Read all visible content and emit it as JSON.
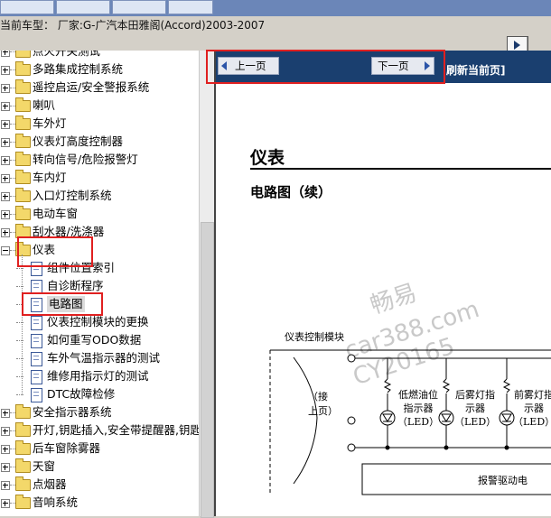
{
  "header": {
    "car_label": "当前车型：  厂家:G-广汽本田雅阁(Accord)2003-2007"
  },
  "tree": {
    "items": [
      {
        "label": "点火开关测试",
        "type": "folder"
      },
      {
        "label": "多路集成控制系统",
        "type": "folder"
      },
      {
        "label": "遥控启运/安全警报系统",
        "type": "folder"
      },
      {
        "label": "喇叭",
        "type": "folder"
      },
      {
        "label": "车外灯",
        "type": "folder"
      },
      {
        "label": "仪表灯高度控制器",
        "type": "folder"
      },
      {
        "label": "转向信号/危险报警灯",
        "type": "folder"
      },
      {
        "label": "车内灯",
        "type": "folder"
      },
      {
        "label": "入口灯控制系统",
        "type": "folder"
      },
      {
        "label": "电动车窗",
        "type": "folder"
      },
      {
        "label": "刮水器/洗涤器",
        "type": "folder"
      },
      {
        "label": "仪表",
        "type": "folder-open"
      },
      {
        "label": "组件位置索引",
        "type": "doc"
      },
      {
        "label": "自诊断程序",
        "type": "doc"
      },
      {
        "label": "电路图",
        "type": "doc",
        "selected": true
      },
      {
        "label": "仪表控制模块的更换",
        "type": "doc"
      },
      {
        "label": "如何重写ODO数据",
        "type": "doc"
      },
      {
        "label": "车外气温指示器的测试",
        "type": "doc"
      },
      {
        "label": "维修用指示灯的测试",
        "type": "doc"
      },
      {
        "label": "DTC故障检修",
        "type": "doc"
      },
      {
        "label": "安全指示器系统",
        "type": "folder"
      },
      {
        "label": "开灯,钥匙插入,安全带提醒器,钥匙灯计",
        "type": "folder"
      },
      {
        "label": "后车窗除雾器",
        "type": "folder"
      },
      {
        "label": "天窗",
        "type": "folder"
      },
      {
        "label": "点烟器",
        "type": "folder"
      },
      {
        "label": "音响系统",
        "type": "folder"
      }
    ]
  },
  "nav": {
    "prev_label": "上一页",
    "next_label": "下一页",
    "refresh_label": "刷新当前页]"
  },
  "page": {
    "title": "仪表",
    "subtitle": "电路图（续）",
    "watermark_1": "畅易",
    "watermark_2": "car388.com",
    "watermark_3": "CY20165"
  },
  "diagram": {
    "module_label": "仪表控制模块",
    "left_note": "（接上页）",
    "lamps": [
      {
        "label": "低燃油位指示器（LED）"
      },
      {
        "label": "后雾灯指示器（LED）"
      },
      {
        "label": "前雾灯指示器（LED）"
      }
    ],
    "driver_label": "报警驱动电"
  }
}
